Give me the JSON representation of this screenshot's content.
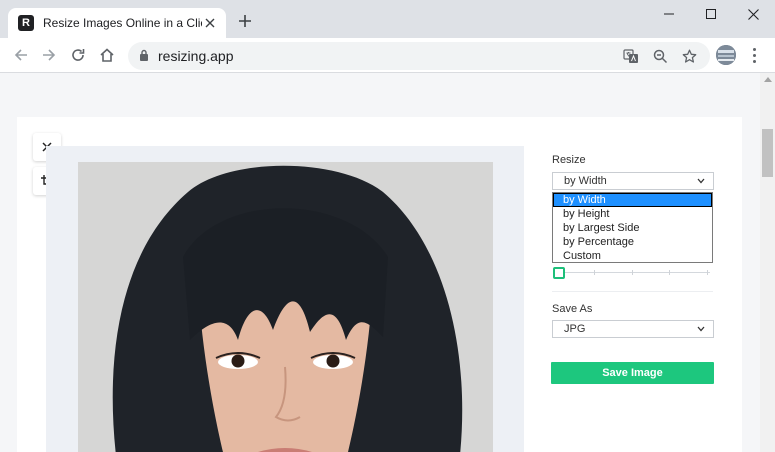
{
  "browser": {
    "tab": {
      "favicon_letter": "R",
      "title": "Resize Images Online in a Click"
    },
    "address": {
      "url": "resizing.app"
    },
    "icons": {
      "back": "arrow-left-icon",
      "forward": "arrow-right-icon",
      "reload": "reload-icon",
      "home": "home-icon",
      "translate": "translate-icon",
      "zoom": "zoom-icon",
      "bookmark": "star-icon",
      "profile": "avatar",
      "menu": "more-vert-icon"
    }
  },
  "editor": {
    "tools": {
      "close": "close-icon",
      "crop": "crop-icon"
    },
    "resize": {
      "label": "Resize",
      "selected": "by Width",
      "options": [
        "by Width",
        "by Height",
        "by Largest Side",
        "by Percentage",
        "Custom"
      ],
      "highlighted_index": 0
    },
    "slider": {
      "value_fraction": 0.0
    },
    "save_as": {
      "label": "Save As",
      "selected": "JPG"
    },
    "save_button": "Save Image"
  },
  "colors": {
    "accent": "#1dc77e",
    "dropdown_highlight": "#1e90ff"
  }
}
